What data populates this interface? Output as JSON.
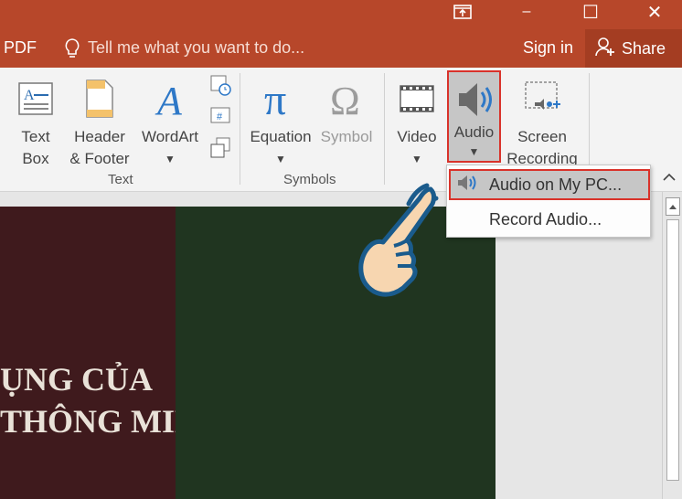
{
  "window": {
    "restore_icon": "ribbon-display-icon",
    "minimize": "–",
    "maximize": "☐",
    "close": "✕"
  },
  "tellbar": {
    "pdf_label": "PDF",
    "tell_me": "Tell me what you want to do...",
    "sign_in": "Sign in",
    "share": "Share"
  },
  "ribbon": {
    "text_box": [
      "Text",
      "Box"
    ],
    "header_footer": [
      "Header",
      "& Footer"
    ],
    "wordart": "WordArt",
    "equation": "Equation",
    "symbol": "Symbol",
    "video": "Video",
    "audio": "Audio",
    "screen_recording": [
      "Screen",
      "Recording"
    ],
    "group_text": "Text",
    "group_symbols": "Symbols"
  },
  "audio_menu": {
    "item1": "Audio on My PC...",
    "item2": "Record Audio..."
  },
  "slide": {
    "line1": "ỤNG CỦA",
    "line2": "THÔNG MINH"
  },
  "colors": {
    "accent": "#b7472a",
    "highlight_border": "#d9322a",
    "slide_left": "#3f1a1d",
    "slide_right": "#203520"
  }
}
